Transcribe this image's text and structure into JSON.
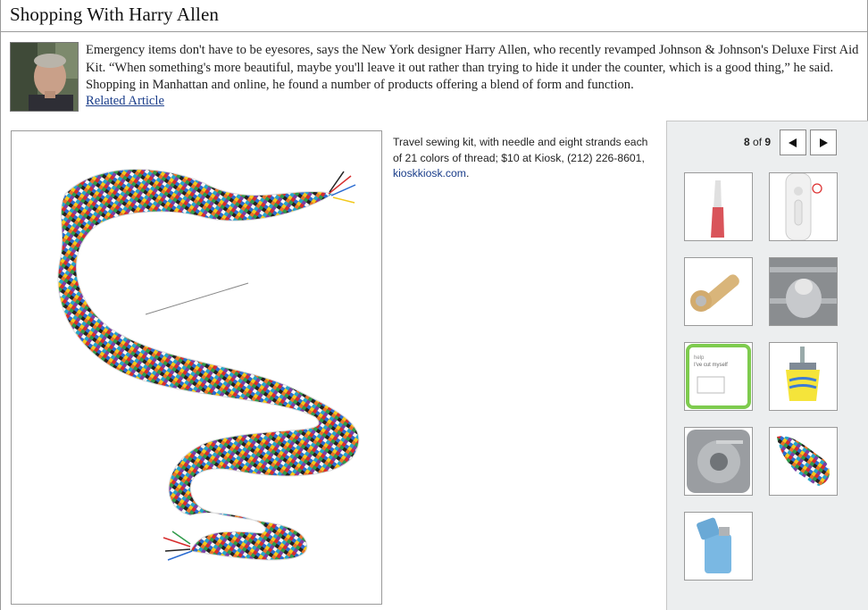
{
  "page": {
    "title": "Shopping With Harry Allen",
    "intro": "Emergency items don't have to be eyesores, says the New York designer Harry Allen, who recently revamped Johnson & Johnson's Deluxe First Aid Kit. “When something's more beautiful, maybe you'll leave it out rather than trying to hide it under the counter, which is a good thing,” he said. Shopping in Manhattan and online, he found a number of products offering a blend of form and function.",
    "related_link": "Related Article"
  },
  "slideshow": {
    "caption_text": "Travel sewing kit, with needle and eight strands each of 21 colors of thread; $10 at Kiosk, (212) 226-8601, ",
    "caption_link": "kioskkiosk.com",
    "caption_end": ".",
    "current": "8",
    "of_label": "of",
    "total": "9",
    "prev_icon": "left-triangle-icon",
    "next_icon": "right-triangle-icon",
    "thumbs": [
      {
        "name": "thumb-1-tweezers-icon"
      },
      {
        "name": "thumb-2-flashlight-icon"
      },
      {
        "name": "thumb-3-wooden-flashlight-icon"
      },
      {
        "name": "thumb-4-metal-lamp-icon"
      },
      {
        "name": "thumb-5-first-aid-kit-icon",
        "label_top": "help",
        "label_main": "I've cut myself"
      },
      {
        "name": "thumb-6-yellow-tool-icon"
      },
      {
        "name": "thumb-7-grater-icon"
      },
      {
        "name": "thumb-8-sewing-kit-icon"
      },
      {
        "name": "thumb-9-blue-lighter-icon"
      }
    ]
  },
  "colors": {
    "link": "#1a3d8a",
    "panel_bg": "#eceeef",
    "border": "#9a9a9a"
  }
}
